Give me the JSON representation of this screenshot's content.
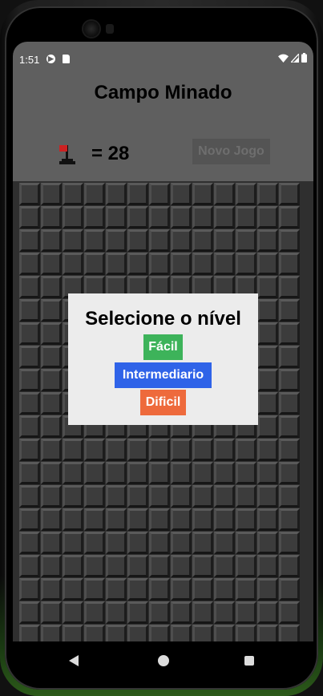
{
  "status_bar": {
    "time": "1:51",
    "icons": [
      "google-play-icon",
      "sd-card-icon",
      "wifi-icon",
      "signal-icon",
      "battery-icon"
    ]
  },
  "app": {
    "title": "Campo Minado",
    "flag_icon": "flag-icon",
    "flag_count": "= 28",
    "new_game_label": "Novo Jogo"
  },
  "board": {
    "columns": 13,
    "rows": 20
  },
  "dialog": {
    "title": "Selecione o nível",
    "levels": [
      {
        "label": "Fácil",
        "color": "#3db35a"
      },
      {
        "label": "Intermediario",
        "color": "#2f63e8"
      },
      {
        "label": "Dificil",
        "color": "#ee6a3c"
      }
    ]
  },
  "nav": {
    "icons": [
      "back-icon",
      "home-icon",
      "recent-apps-icon"
    ]
  },
  "colors": {
    "header_bg": "#5f5f5f",
    "board_bg": "#2f2f2f",
    "dialog_bg": "#ececec",
    "flag_red": "#cc2222"
  }
}
